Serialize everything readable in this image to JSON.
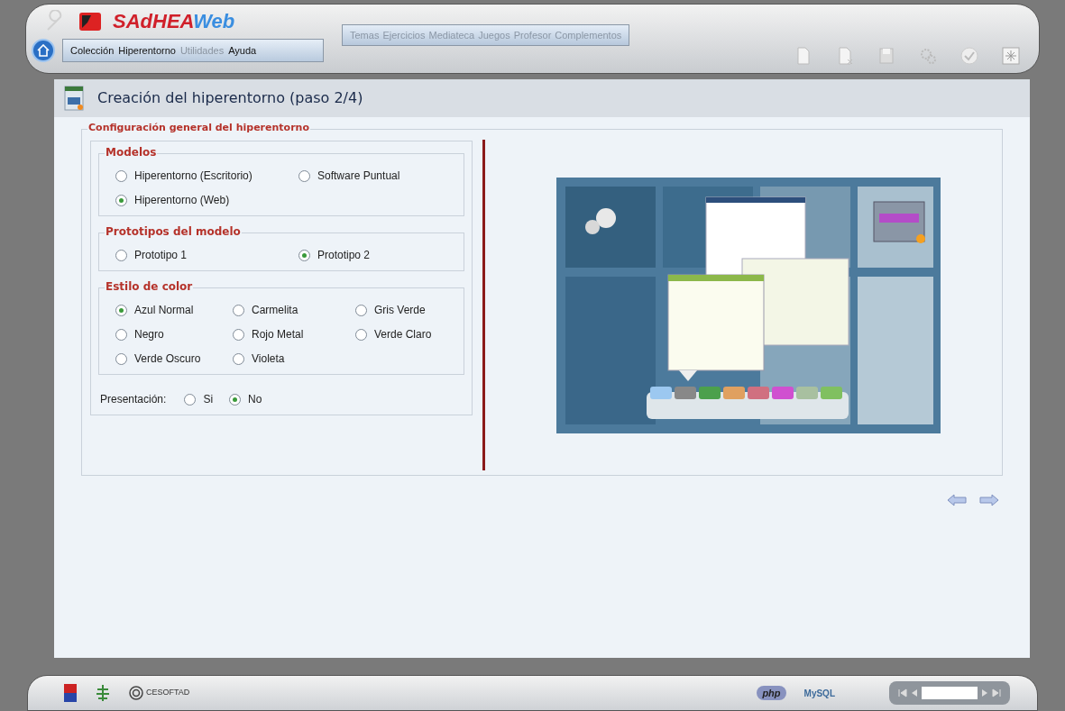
{
  "logo": {
    "part1": "SAdHEA",
    "part2": "Web"
  },
  "main_menu": [
    {
      "label": "Colección",
      "disabled": false
    },
    {
      "label": "Hiperentorno",
      "disabled": false
    },
    {
      "label": "Utilidades",
      "disabled": true
    },
    {
      "label": "Ayuda",
      "disabled": false
    }
  ],
  "module_menu": [
    {
      "label": "Temas",
      "disabled": true
    },
    {
      "label": "Ejercicios",
      "disabled": true
    },
    {
      "label": "Mediateca",
      "disabled": true
    },
    {
      "label": "Juegos",
      "disabled": true
    },
    {
      "label": "Profesor",
      "disabled": true
    },
    {
      "label": "Complementos",
      "disabled": true
    }
  ],
  "page_title": "Creación del hiperentorno (paso 2/4)",
  "fieldset": {
    "legend": "Configuración general del hiperentorno",
    "groups": [
      {
        "legend": "Modelos",
        "options": [
          {
            "label": "Hiperentorno (Escritorio)",
            "selected": false
          },
          {
            "label": "Software Puntual",
            "selected": false
          },
          {
            "label": "Hiperentorno (Web)",
            "selected": true
          }
        ]
      },
      {
        "legend": "Prototipos del modelo",
        "options": [
          {
            "label": "Prototipo 1",
            "selected": false
          },
          {
            "label": "Prototipo 2",
            "selected": true
          }
        ]
      },
      {
        "legend": "Estilo de color",
        "options": [
          {
            "label": "Azul Normal",
            "selected": true
          },
          {
            "label": "Carmelita",
            "selected": false
          },
          {
            "label": "Gris Verde",
            "selected": false
          },
          {
            "label": "Negro",
            "selected": false
          },
          {
            "label": "Rojo Metal",
            "selected": false
          },
          {
            "label": "Verde Claro",
            "selected": false
          },
          {
            "label": "Verde Oscuro",
            "selected": false
          },
          {
            "label": "Violeta",
            "selected": false
          }
        ]
      }
    ],
    "presentation": {
      "label": "Presentación:",
      "options": [
        {
          "label": "Si",
          "selected": false
        },
        {
          "label": "No",
          "selected": true
        }
      ]
    }
  },
  "footer": {
    "org": "CESOFTAD",
    "php": "php",
    "mysql": "MySQL"
  }
}
